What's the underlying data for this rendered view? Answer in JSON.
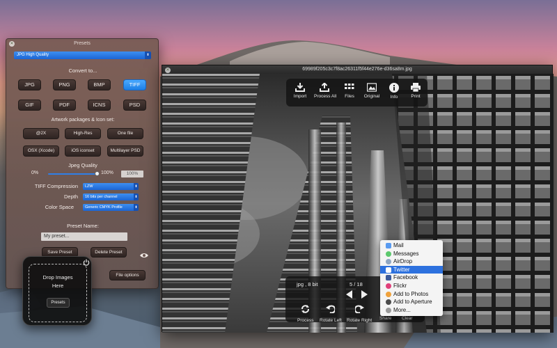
{
  "presets_panel": {
    "title": "Presets",
    "selected_preset": "JPG High Quality",
    "convert_to_label": "Convert to...",
    "formats": [
      "JPG",
      "PNG",
      "BMP",
      "TIFF",
      "GIF",
      "PDF",
      "ICNS",
      "PSD"
    ],
    "active_format": "TIFF",
    "artwork_label": "Artwork packages & Icon set:",
    "artwork_buttons": [
      "@2X",
      "High-Res",
      "One file",
      "OSX (Xcode)",
      "iOS iconset",
      "Multilayer PSD"
    ],
    "jpeg_quality_label": "Jpeg Quality",
    "quality_min": "0%",
    "quality_max": "100%",
    "quality_value": "100%",
    "quality_level": 1.0,
    "tiff_compression_label": "TIFF Compression",
    "tiff_compression_value": "LZW",
    "depth_label": "Depth",
    "depth_value": "16 bits per channel",
    "color_space_label": "Color Space",
    "color_space_value": "Generic CMYK Profile",
    "preset_name_label": "Preset Name:",
    "preset_name_value": "My preset...",
    "save_preset": "Save Preset",
    "delete_preset": "Delete Preset",
    "file_options": "File options"
  },
  "drop_widget": {
    "text_line1": "Drop Images",
    "text_line2": "Here",
    "presets_button": "Presets"
  },
  "viewer": {
    "title": "69989f205c3c7f8ac26311f5f44e276e-d36sa8m.jpg",
    "toolbar": [
      "Import",
      "Process All",
      "Files",
      "Original",
      "Info",
      "Print"
    ],
    "file_info": "jpg , 8 bit",
    "page_counter": "5 / 18",
    "bottom_actions": [
      "Process",
      "Rotate Left",
      "Rotate Right",
      "Share",
      "Clear"
    ]
  },
  "share_menu": {
    "items": [
      "Mail",
      "Messages",
      "AirDrop",
      "Twitter",
      "Facebook",
      "Flickr",
      "Add to Photos",
      "Add to Aperture",
      "More..."
    ],
    "selected": "Twitter",
    "icon_colors": [
      "#5a9bf0",
      "#5cc86e",
      "#8fa6c2",
      "#ffffff",
      "#3b5a9a",
      "#e0407a",
      "#f0a23c",
      "#4b4b4b",
      "#9a9a9a"
    ]
  },
  "colors": {
    "accent": "#1e7fe6",
    "selection": "#2d71de"
  }
}
